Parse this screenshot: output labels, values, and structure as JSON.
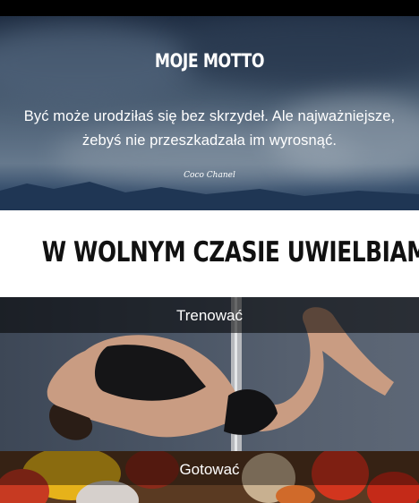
{
  "motto": {
    "title": "MOJE MOTTO",
    "quote_line1": "Być może urodziłaś się bez skrzydeł. Ale najważniejsze,",
    "quote_line2": "żebyś nie przeszkadzała im wyrosnąć.",
    "author": "Coco Chanel"
  },
  "hobbies": {
    "title": "W WOLNYM CZASIE UWIELBIAM",
    "items": [
      {
        "label": "Trenować"
      },
      {
        "label": "Gotować"
      }
    ]
  }
}
